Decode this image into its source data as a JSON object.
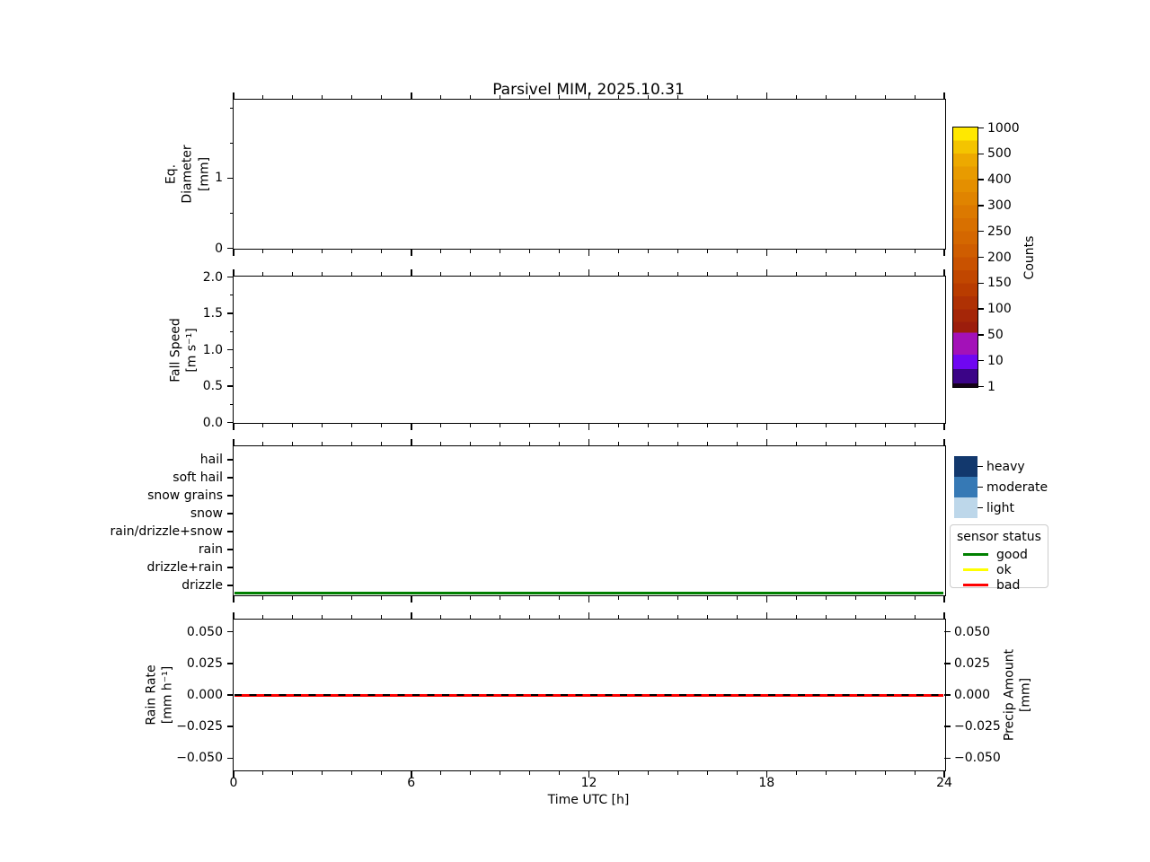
{
  "figure": {
    "title": "Parsivel MIM, 2025.10.31",
    "background_color": "#ffffff"
  },
  "x_axis": {
    "label": "Time UTC [h]",
    "range": [
      0,
      24
    ],
    "tick_values": [
      0,
      6,
      12,
      18,
      24
    ],
    "tick_labels": [
      "0",
      "6",
      "12",
      "18",
      "24"
    ],
    "minor_step_hours": 1
  },
  "chart_data": [
    {
      "id": "eq-diameter",
      "type": "heatmap",
      "ylabel_lines": [
        "Eq.",
        "Diameter",
        "[mm]"
      ],
      "ylim": [
        0,
        2.115
      ],
      "ytick_values": [
        0,
        1
      ],
      "ytick_labels": [
        "0",
        "1"
      ],
      "yminor_values": [
        0.5,
        1.5,
        2.0
      ],
      "xlim": [
        0,
        24
      ],
      "values": []
    },
    {
      "id": "fall-speed",
      "type": "heatmap",
      "ylabel_lines": [
        "Fall Speed",
        "[m s⁻¹]"
      ],
      "ylim": [
        0,
        2.0
      ],
      "ytick_values": [
        0.0,
        0.5,
        1.0,
        1.5,
        2.0
      ],
      "ytick_labels": [
        "0.0",
        "0.5",
        "1.0",
        "1.5",
        "2.0"
      ],
      "yminor_values": [
        0.25,
        0.75,
        1.25,
        1.75
      ],
      "xlim": [
        0,
        24
      ],
      "values": []
    },
    {
      "id": "weather-code",
      "type": "line",
      "categories": [
        "hail",
        "soft hail",
        "snow grains",
        "snow",
        "rain/drizzle+snow",
        "rain",
        "drizzle+rain",
        "drizzle"
      ],
      "xlim": [
        0,
        24
      ],
      "series": [
        {
          "name": "sensor status",
          "value": "good",
          "color": "#008000",
          "x": [
            0,
            24
          ],
          "y_level": "baseline below drizzle"
        }
      ]
    },
    {
      "id": "rain-rate",
      "type": "line",
      "ylabel_lines": [
        "Rain Rate",
        "[mm h⁻¹]"
      ],
      "right_ylabel_lines": [
        "Precip Amount",
        "[mm]"
      ],
      "ylim": [
        -0.0593,
        0.0593
      ],
      "ytick_values": [
        0.05,
        0.025,
        0,
        -0.025,
        -0.05
      ],
      "ytick_labels": [
        "0.050",
        "0.025",
        "0.000",
        "−0.025",
        "−0.050"
      ],
      "xlim": [
        0,
        24
      ],
      "series": [
        {
          "name": "rain rate",
          "color": "#ff0000",
          "style": "solid",
          "x": [
            0,
            24
          ],
          "y": [
            0.0,
            0.0
          ]
        },
        {
          "name": "precip amount",
          "color": "#000000",
          "style": "dashed",
          "x": [
            0,
            24
          ],
          "y": [
            0.0,
            0.0
          ]
        }
      ]
    }
  ],
  "colorbar": {
    "label": "Counts",
    "tick_labels": [
      "1000",
      "500",
      "400",
      "300",
      "250",
      "200",
      "150",
      "100",
      "50",
      "10",
      "1"
    ],
    "gradient_stops": [
      {
        "pos": 0.0,
        "color": "#ffe800"
      },
      {
        "pos": 0.05,
        "color": "#f4c400"
      },
      {
        "pos": 0.1,
        "color": "#eda900"
      },
      {
        "pos": 0.15,
        "color": "#e89b00"
      },
      {
        "pos": 0.2,
        "color": "#e48f00"
      },
      {
        "pos": 0.25,
        "color": "#e08400"
      },
      {
        "pos": 0.3,
        "color": "#dc7900"
      },
      {
        "pos": 0.35,
        "color": "#d87000"
      },
      {
        "pos": 0.4,
        "color": "#d46700"
      },
      {
        "pos": 0.45,
        "color": "#cf5d00"
      },
      {
        "pos": 0.5,
        "color": "#c95200"
      },
      {
        "pos": 0.55,
        "color": "#c14700"
      },
      {
        "pos": 0.6,
        "color": "#b93c00"
      },
      {
        "pos": 0.65,
        "color": "#af3104"
      },
      {
        "pos": 0.7,
        "color": "#a52608"
      },
      {
        "pos": 0.75,
        "color": "#9c1d0c"
      },
      {
        "pos": 0.79,
        "color": "#a311b8"
      },
      {
        "pos": 0.875,
        "color": "#6f06f2"
      },
      {
        "pos": 0.93,
        "color": "#3b0487"
      },
      {
        "pos": 0.986,
        "color": "#150218"
      }
    ]
  },
  "intensity_legend": {
    "items": [
      {
        "label": "heavy",
        "color": "#12386d"
      },
      {
        "label": "moderate",
        "color": "#3679b5"
      },
      {
        "label": "light",
        "color": "#bdd7ea"
      }
    ]
  },
  "sensor_legend": {
    "title": "sensor status",
    "items": [
      {
        "label": "good",
        "color": "#008000"
      },
      {
        "label": "ok",
        "color": "#ffff00"
      },
      {
        "label": "bad",
        "color": "#ff0000"
      }
    ]
  }
}
